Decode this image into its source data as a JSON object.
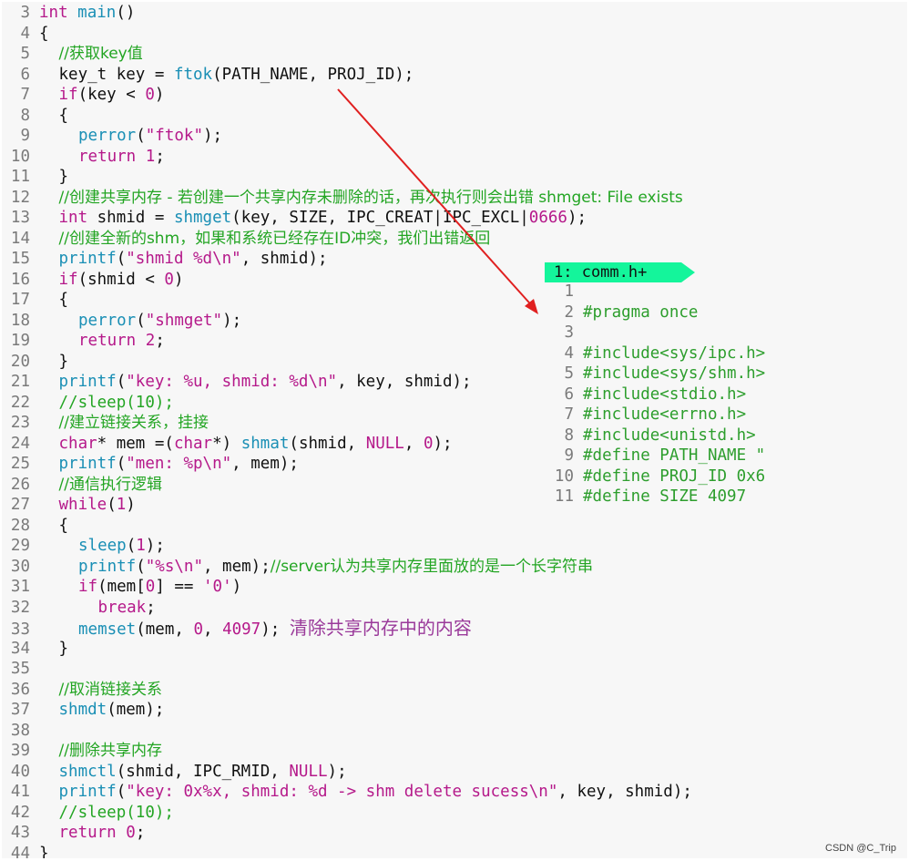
{
  "main_file": {
    "lines": [
      {
        "n": "3",
        "ind": 0,
        "tokens": [
          [
            "k",
            "int"
          ],
          [
            "p",
            " "
          ],
          [
            "f",
            "main"
          ],
          [
            "p",
            "()"
          ]
        ]
      },
      {
        "n": "4",
        "ind": 0,
        "tokens": [
          [
            "p",
            "{"
          ]
        ]
      },
      {
        "n": "5",
        "ind": 1,
        "tokens": [
          [
            "c",
            "//获取key值"
          ]
        ]
      },
      {
        "n": "6",
        "ind": 1,
        "tokens": [
          [
            "p",
            "key_t key = "
          ],
          [
            "f",
            "ftok"
          ],
          [
            "p",
            "(PATH_NAME, PROJ_ID);"
          ]
        ]
      },
      {
        "n": "7",
        "ind": 1,
        "tokens": [
          [
            "k",
            "if"
          ],
          [
            "p",
            "(key < "
          ],
          [
            "n",
            "0"
          ],
          [
            "p",
            ")"
          ]
        ]
      },
      {
        "n": "8",
        "ind": 1,
        "tokens": [
          [
            "p",
            "{"
          ]
        ]
      },
      {
        "n": "9",
        "ind": 2,
        "tokens": [
          [
            "f",
            "perror"
          ],
          [
            "p",
            "("
          ],
          [
            "s",
            "\"ftok\""
          ],
          [
            "p",
            ");"
          ]
        ]
      },
      {
        "n": "10",
        "ind": 2,
        "tokens": [
          [
            "k",
            "return"
          ],
          [
            "p",
            " "
          ],
          [
            "n",
            "1"
          ],
          [
            "p",
            ";"
          ]
        ]
      },
      {
        "n": "11",
        "ind": 1,
        "tokens": [
          [
            "p",
            "}"
          ]
        ]
      },
      {
        "n": "12",
        "ind": 1,
        "tokens": [
          [
            "c",
            "//创建共享内存 - 若创建一个共享内存未删除的话，再次执行则会出错 shmget: File exists"
          ]
        ]
      },
      {
        "n": "13",
        "ind": 1,
        "tokens": [
          [
            "k",
            "int"
          ],
          [
            "p",
            " shmid = "
          ],
          [
            "f",
            "shmget"
          ],
          [
            "p",
            "(key, SIZE, IPC_CREAT|IPC_EXCL|"
          ],
          [
            "n",
            "0666"
          ],
          [
            "p",
            ");"
          ]
        ]
      },
      {
        "n": "14",
        "ind": 1,
        "tokens": [
          [
            "c",
            "//创建全新的shm，如果和系统已经存在ID冲突，我们出错返回"
          ]
        ]
      },
      {
        "n": "15",
        "ind": 1,
        "tokens": [
          [
            "f",
            "printf"
          ],
          [
            "p",
            "("
          ],
          [
            "s",
            "\"shmid %d\\n\""
          ],
          [
            "p",
            ", shmid);"
          ]
        ]
      },
      {
        "n": "16",
        "ind": 1,
        "tokens": [
          [
            "k",
            "if"
          ],
          [
            "p",
            "(shmid < "
          ],
          [
            "n",
            "0"
          ],
          [
            "p",
            ")"
          ]
        ]
      },
      {
        "n": "17",
        "ind": 1,
        "tokens": [
          [
            "p",
            "{"
          ]
        ]
      },
      {
        "n": "18",
        "ind": 2,
        "tokens": [
          [
            "f",
            "perror"
          ],
          [
            "p",
            "("
          ],
          [
            "s",
            "\"shmget\""
          ],
          [
            "p",
            ");"
          ]
        ]
      },
      {
        "n": "19",
        "ind": 2,
        "tokens": [
          [
            "k",
            "return"
          ],
          [
            "p",
            " "
          ],
          [
            "n",
            "2"
          ],
          [
            "p",
            ";"
          ]
        ]
      },
      {
        "n": "20",
        "ind": 1,
        "tokens": [
          [
            "p",
            "}"
          ]
        ]
      },
      {
        "n": "21",
        "ind": 1,
        "tokens": [
          [
            "f",
            "printf"
          ],
          [
            "p",
            "("
          ],
          [
            "s",
            "\"key: %u, shmid: %d\\n\""
          ],
          [
            "p",
            ", key, shmid);"
          ]
        ]
      },
      {
        "n": "22",
        "ind": 1,
        "tokens": [
          [
            "c",
            "//sleep(10);"
          ]
        ]
      },
      {
        "n": "23",
        "ind": 1,
        "tokens": [
          [
            "c",
            "//建立链接关系，挂接"
          ]
        ]
      },
      {
        "n": "24",
        "ind": 1,
        "tokens": [
          [
            "k",
            "char"
          ],
          [
            "p",
            "* mem =("
          ],
          [
            "k",
            "char"
          ],
          [
            "p",
            "*) "
          ],
          [
            "f",
            "shmat"
          ],
          [
            "p",
            "(shmid, "
          ],
          [
            "n",
            "NULL"
          ],
          [
            "p",
            ", "
          ],
          [
            "n",
            "0"
          ],
          [
            "p",
            ");"
          ]
        ]
      },
      {
        "n": "25",
        "ind": 1,
        "tokens": [
          [
            "f",
            "printf"
          ],
          [
            "p",
            "("
          ],
          [
            "s",
            "\"men: %p\\n\""
          ],
          [
            "p",
            ", mem);"
          ]
        ]
      },
      {
        "n": "26",
        "ind": 1,
        "tokens": [
          [
            "c",
            "//通信执行逻辑"
          ]
        ]
      },
      {
        "n": "27",
        "ind": 1,
        "tokens": [
          [
            "k",
            "while"
          ],
          [
            "p",
            "("
          ],
          [
            "n",
            "1"
          ],
          [
            "p",
            ")"
          ]
        ]
      },
      {
        "n": "28",
        "ind": 1,
        "tokens": [
          [
            "p",
            "{"
          ]
        ]
      },
      {
        "n": "29",
        "ind": 2,
        "tokens": [
          [
            "f",
            "sleep"
          ],
          [
            "p",
            "("
          ],
          [
            "n",
            "1"
          ],
          [
            "p",
            ");"
          ]
        ]
      },
      {
        "n": "30",
        "ind": 2,
        "tokens": [
          [
            "f",
            "printf"
          ],
          [
            "p",
            "("
          ],
          [
            "s",
            "\"%s\\n\""
          ],
          [
            "p",
            ", mem);"
          ],
          [
            "c",
            "//server认为共享内存里面放的是一个长字符串"
          ]
        ]
      },
      {
        "n": "31",
        "ind": 2,
        "tokens": [
          [
            "k",
            "if"
          ],
          [
            "p",
            "(mem["
          ],
          [
            "n",
            "0"
          ],
          [
            "p",
            "] == "
          ],
          [
            "s",
            "'0'"
          ],
          [
            "p",
            ")"
          ]
        ]
      },
      {
        "n": "32",
        "ind": 3,
        "tokens": [
          [
            "k",
            "break"
          ],
          [
            "p",
            ";"
          ]
        ]
      },
      {
        "n": "33",
        "ind": 2,
        "tokens": [
          [
            "f",
            "memset"
          ],
          [
            "p",
            "(mem, "
          ],
          [
            "n",
            "0"
          ],
          [
            "p",
            ", "
          ],
          [
            "n",
            "4097"
          ],
          [
            "p",
            "); "
          ],
          [
            "note",
            "清除共享内存中的内容"
          ]
        ]
      },
      {
        "n": "34",
        "ind": 1,
        "tokens": [
          [
            "p",
            "}"
          ]
        ]
      },
      {
        "n": "35",
        "ind": 0,
        "tokens": []
      },
      {
        "n": "36",
        "ind": 1,
        "tokens": [
          [
            "c",
            "//取消链接关系"
          ]
        ]
      },
      {
        "n": "37",
        "ind": 1,
        "tokens": [
          [
            "f",
            "shmdt"
          ],
          [
            "p",
            "(mem);"
          ]
        ]
      },
      {
        "n": "38",
        "ind": 0,
        "tokens": []
      },
      {
        "n": "39",
        "ind": 1,
        "tokens": [
          [
            "c",
            "//删除共享内存"
          ]
        ]
      },
      {
        "n": "40",
        "ind": 1,
        "tokens": [
          [
            "f",
            "shmctl"
          ],
          [
            "p",
            "(shmid, IPC_RMID, "
          ],
          [
            "n",
            "NULL"
          ],
          [
            "p",
            ");"
          ]
        ]
      },
      {
        "n": "41",
        "ind": 1,
        "tokens": [
          [
            "f",
            "printf"
          ],
          [
            "p",
            "("
          ],
          [
            "s",
            "\"key: 0x%x, shmid: %d -> shm delete sucess\\n\""
          ],
          [
            "p",
            ", key, shmid);"
          ]
        ]
      },
      {
        "n": "42",
        "ind": 1,
        "tokens": [
          [
            "c",
            "//sleep(10);"
          ]
        ]
      },
      {
        "n": "43",
        "ind": 1,
        "tokens": [
          [
            "k",
            "return"
          ],
          [
            "p",
            " "
          ],
          [
            "n",
            "0"
          ],
          [
            "p",
            ";"
          ]
        ]
      },
      {
        "n": "44",
        "ind": 0,
        "tokens": [
          [
            "p",
            "}"
          ]
        ]
      }
    ]
  },
  "side_file": {
    "tab_label": "1: comm.h+",
    "lines": [
      {
        "n": "1",
        "text": ""
      },
      {
        "n": "2",
        "text": "#pragma once"
      },
      {
        "n": "3",
        "text": ""
      },
      {
        "n": "4",
        "text": "#include<sys/ipc.h>"
      },
      {
        "n": "5",
        "text": "#include<sys/shm.h>"
      },
      {
        "n": "6",
        "text": "#include<stdio.h>"
      },
      {
        "n": "7",
        "text": "#include<errno.h>"
      },
      {
        "n": "8",
        "text": "#include<unistd.h>"
      },
      {
        "n": "9",
        "text": "#define PATH_NAME \""
      },
      {
        "n": "10",
        "text": "#define PROJ_ID 0x6"
      },
      {
        "n": "11",
        "text": "#define SIZE 4097"
      }
    ]
  },
  "watermark": "CSDN @C_Trip",
  "colors": {
    "keyword": "#b5198a",
    "function": "#1a8fb5",
    "comment": "#23a523",
    "tab_bg": "#14f59b",
    "arrow": "#e02020",
    "note": "#9a3a9a"
  }
}
